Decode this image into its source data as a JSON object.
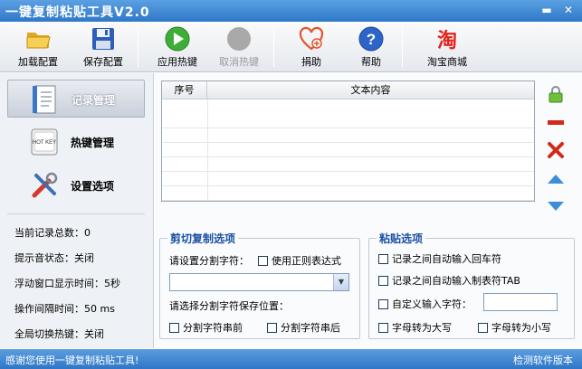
{
  "window": {
    "title": "一键复制粘贴工具V2.0",
    "minimize_glyph": "▬",
    "close_glyph": "✕"
  },
  "toolbar": {
    "load_config": "加载配置",
    "save_config": "保存配置",
    "apply_hotkey": "应用热键",
    "cancel_hotkey": "取消热键",
    "donate": "捐助",
    "help": "帮助",
    "taobao": "淘宝商城",
    "taobao_glyph": "淘",
    "help_glyph": "?"
  },
  "sidebar": {
    "items": [
      {
        "label": "记录管理",
        "active": true,
        "icon": "document-icon"
      },
      {
        "label": "热键管理",
        "active": false,
        "icon": "hotkey-icon"
      },
      {
        "label": "设置选项",
        "active": false,
        "icon": "tools-icon"
      }
    ],
    "hotkey_icon_text": "HOT KEY",
    "stats": [
      "当前记录总数：0",
      "提示音状态：关闭",
      "浮动窗口显示时间：5秒",
      "操作间隔时间：50 ms",
      "全局切换热键：关闭"
    ]
  },
  "records_table": {
    "columns": [
      "序号",
      "文本内容"
    ],
    "rows": []
  },
  "cut_copy_options": {
    "title": "剪切复制选项",
    "separator_label": "请设置分割字符：",
    "use_regex": "使用正则表达式",
    "separator_value": "",
    "save_position_label": "请选择分割字符保存位置：",
    "before_string": "分割字符串前",
    "after_string": "分割字符串后"
  },
  "paste_options": {
    "title": "粘贴选项",
    "auto_enter": "记录之间自动输入回车符",
    "auto_tab": "记录之间自动输入制表符TAB",
    "custom_char": "自定义输入字符：",
    "custom_char_value": "",
    "to_upper": "字母转为大写",
    "to_lower": "字母转为小写"
  },
  "status": {
    "message": "感谢您使用一键复制粘贴工具!",
    "version": "检测软件版本"
  },
  "colors": {
    "title_bar": "#2f78c8",
    "group_title": "#1a4fa5",
    "delete_red": "#d12a1a",
    "arrow_blue": "#3a8fd8"
  }
}
